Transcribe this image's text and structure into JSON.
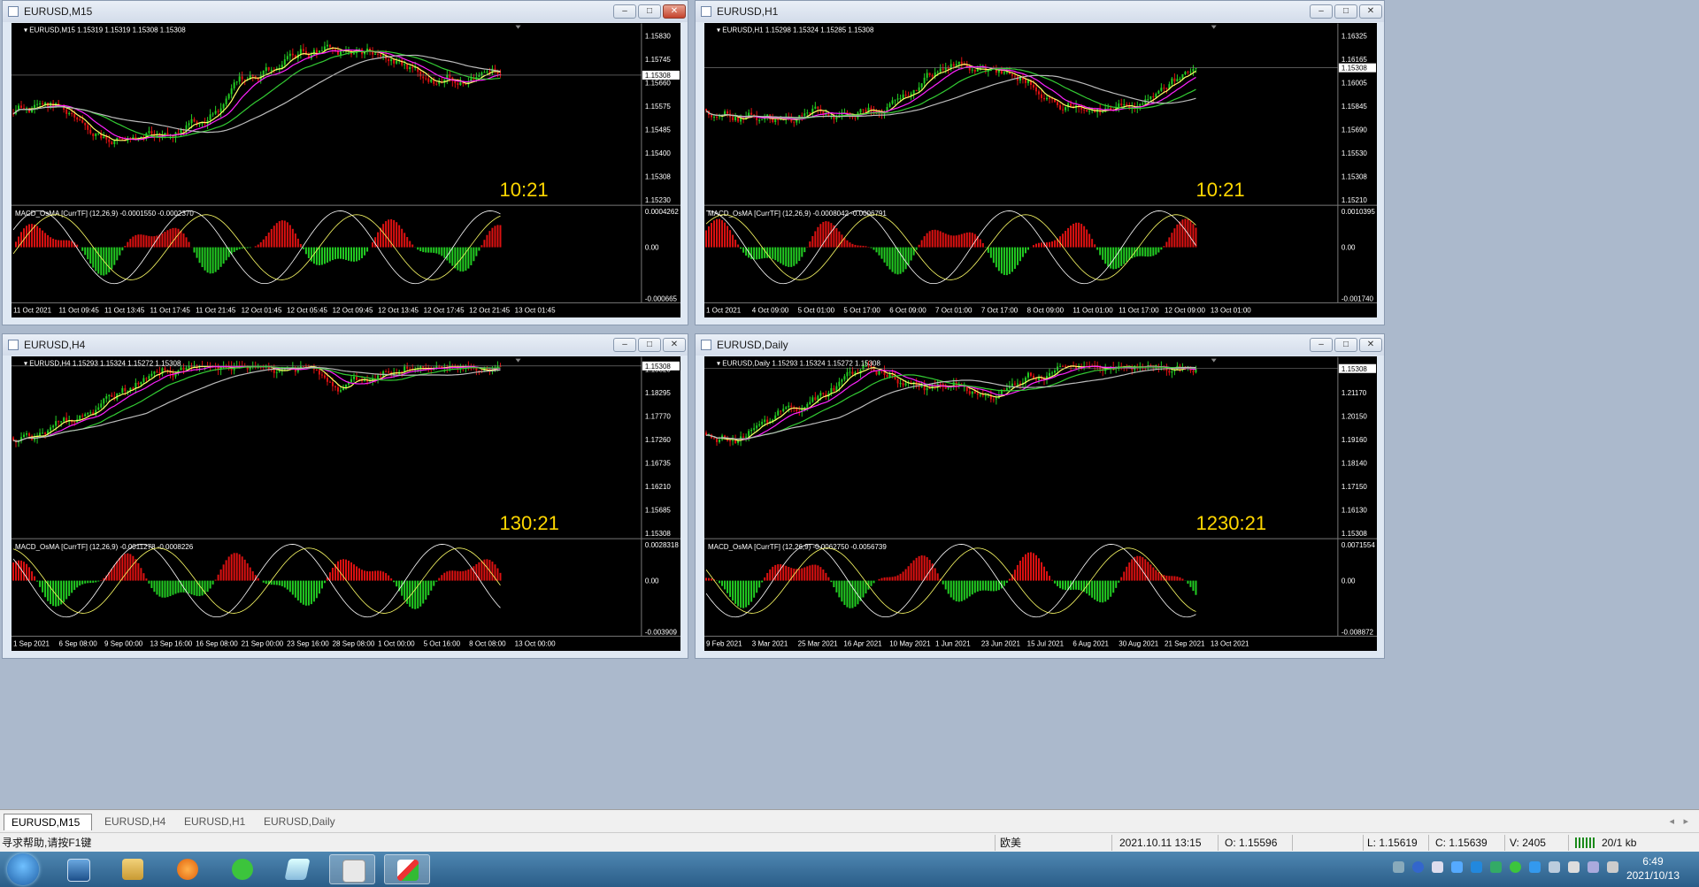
{
  "windows": [
    {
      "title": "EURUSD,M15",
      "info": "EURUSD,M15  1.15319 1.15319 1.15308 1.15308",
      "price_axis": [
        "1.15830",
        "1.15745",
        "1.15660",
        "1.15575",
        "1.15485",
        "1.15400",
        "1.15308",
        "1.15230"
      ],
      "current_price": "1.15308",
      "timer": "10:21",
      "macd_label": "MACD_OsMA [CurrTF] (12,26,9) -0.0001550 -0.0002370",
      "macd_axis": [
        "0.0004262",
        "0.00",
        "-0.000665"
      ],
      "time_axis": [
        "11 Oct 2021",
        "11 Oct 09:45",
        "11 Oct 13:45",
        "11 Oct 17:45",
        "11 Oct 21:45",
        "12 Oct 01:45",
        "12 Oct 05:45",
        "12 Oct 09:45",
        "12 Oct 13:45",
        "12 Oct 17:45",
        "12 Oct 21:45",
        "13 Oct 01:45"
      ],
      "active": true
    },
    {
      "title": "EURUSD,H1",
      "info": "EURUSD,H1  1.15298 1.15324 1.15285 1.15308",
      "price_axis": [
        "1.16325",
        "1.16165",
        "1.16005",
        "1.15845",
        "1.15690",
        "1.15530",
        "1.15308",
        "1.15210"
      ],
      "current_price": "1.15308",
      "timer": "10:21",
      "macd_label": "MACD_OsMA [CurrTF] (12,26,9) -0.0008042 -0.0006791",
      "macd_axis": [
        "0.0010395",
        "0.00",
        "-0.001740"
      ],
      "time_axis": [
        "1 Oct 2021",
        "4 Oct 09:00",
        "5 Oct 01:00",
        "5 Oct 17:00",
        "6 Oct 09:00",
        "7 Oct 01:00",
        "7 Oct 17:00",
        "8 Oct 09:00",
        "11 Oct 01:00",
        "11 Oct 17:00",
        "12 Oct 09:00",
        "13 Oct 01:00"
      ],
      "active": false
    },
    {
      "title": "EURUSD,H4",
      "info": "EURUSD,H4  1.15293 1.15324 1.15272 1.15308",
      "price_axis": [
        "1.18820",
        "1.18295",
        "1.17770",
        "1.17260",
        "1.16735",
        "1.16210",
        "1.15685",
        "1.15308"
      ],
      "current_price": "1.15308",
      "timer": "130:21",
      "macd_label": "MACD_OsMA [CurrTF] (12,26,9) -0.0011278 -0.0008226",
      "macd_axis": [
        "0.0028318",
        "0.00",
        "-0.003909"
      ],
      "time_axis": [
        "1 Sep 2021",
        "6 Sep 08:00",
        "9 Sep 00:00",
        "13 Sep 16:00",
        "16 Sep 08:00",
        "21 Sep 00:00",
        "23 Sep 16:00",
        "28 Sep 08:00",
        "1 Oct 00:00",
        "5 Oct 16:00",
        "8 Oct 08:00",
        "13 Oct 00:00"
      ],
      "active": false
    },
    {
      "title": "EURUSD,Daily",
      "info": "EURUSD,Daily  1.15293 1.15324 1.15272 1.15308",
      "price_axis": [
        "1.22160",
        "1.21170",
        "1.20150",
        "1.19160",
        "1.18140",
        "1.17150",
        "1.16130",
        "1.15308"
      ],
      "current_price": "1.15308",
      "timer": "1230:21",
      "macd_label": "MACD_OsMA [CurrTF] (12,26,9) -0.0062750 -0.0056739",
      "macd_axis": [
        "0.0071554",
        "0.00",
        "-0.008872"
      ],
      "time_axis": [
        "9 Feb 2021",
        "3 Mar 2021",
        "25 Mar 2021",
        "16 Apr 2021",
        "10 May 2021",
        "1 Jun 2021",
        "23 Jun 2021",
        "15 Jul 2021",
        "6 Aug 2021",
        "30 Aug 2021",
        "21 Sep 2021",
        "13 Oct 2021"
      ],
      "active": false
    }
  ],
  "tabs": [
    "EURUSD,M15",
    "EURUSD,H4",
    "EURUSD,H1",
    "EURUSD,Daily"
  ],
  "status": {
    "help": "寻求帮助,请按F1键",
    "profile": "欧美",
    "datetime": "2021.10.11 13:15",
    "open": "O: 1.15596",
    "low": "L: 1.15619",
    "close": "C: 1.15639",
    "volume": "V: 2405",
    "traffic": "20/1 kb"
  },
  "clock": {
    "time": "6:49",
    "date": "2021/10/13"
  },
  "colors": {
    "bull": "#22cc22",
    "bear": "#dd1111",
    "ma_fast": "#ffff66",
    "ma_mid": "#ff22ff",
    "ma_slow": "#33cc33",
    "ma_long": "#bbbbbb",
    "timer": "#ffd700"
  },
  "icons": [
    "start-orb-icon",
    "desktop-icon",
    "explorer-icon",
    "browser-icon",
    "wechat-icon",
    "notepad-icon",
    "terminal-icon",
    "metatrader-icon"
  ]
}
